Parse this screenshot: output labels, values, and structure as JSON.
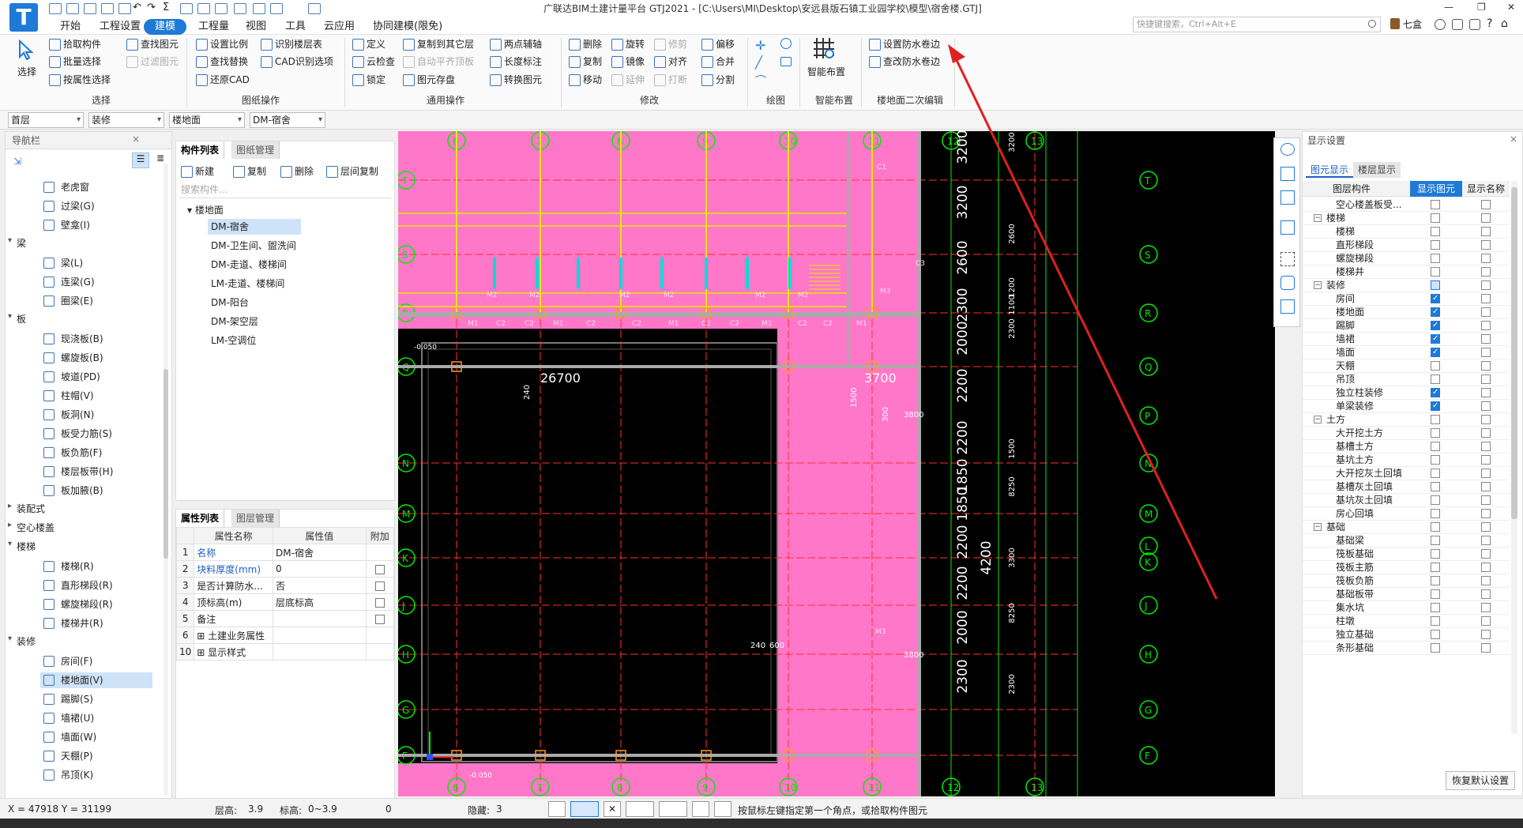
{
  "window": {
    "title": "广联达BIM土建计量平台 GTJ2021 - [C:\\Users\\MI\\Desktop\\安远县版石镇工业园学校\\模型\\宿舍楼.GTJ]",
    "search_placeholder": "快捷键搜索，Ctrl+Alt+E",
    "user": "七盒",
    "logo_letter": "T"
  },
  "menu": [
    "开始",
    "工程设置",
    "建模",
    "工程量",
    "视图",
    "工具",
    "云应用",
    "协同建模(限免)"
  ],
  "ribbon": {
    "select": {
      "big": "选择",
      "items": [
        "拾取构件",
        "批量选择",
        "按属性选择"
      ],
      "group": "选择"
    },
    "find": {
      "items": [
        "查找图元",
        "过滤图元"
      ]
    },
    "drawing_ops": {
      "items": [
        "设置比例",
        "查找替换",
        "还原CAD",
        "识别楼层表",
        "CAD识别选项"
      ],
      "group": "图纸操作"
    },
    "common_ops": {
      "items": [
        "定义",
        "云检查",
        "锁定",
        "复制到其它层",
        "自动平齐顶板",
        "图元存盘",
        "两点辅轴",
        "长度标注",
        "转换图元"
      ],
      "group": "通用操作"
    },
    "modify": {
      "items": [
        "删除",
        "复制",
        "移动",
        "旋转",
        "镜像",
        "延伸",
        "修剪",
        "对齐",
        "打断",
        "偏移",
        "合并",
        "分割"
      ],
      "group": "修改"
    },
    "draw": {
      "group": "绘图"
    },
    "smart": {
      "big": "智能布置",
      "group": "智能布置"
    },
    "floor_edit": {
      "items": [
        "设置防水卷边",
        "查改防水卷边"
      ],
      "group": "楼地面二次编辑"
    }
  },
  "combos": [
    "首层",
    "装修",
    "楼地面",
    "DM-宿舍"
  ],
  "nav": {
    "title": "导航栏",
    "rows": [
      {
        "type": "item",
        "label": "老虎窗"
      },
      {
        "type": "item",
        "label": "过梁(G)"
      },
      {
        "type": "item",
        "label": "壁龛(I)"
      },
      {
        "type": "group",
        "label": "梁"
      },
      {
        "type": "item",
        "label": "梁(L)"
      },
      {
        "type": "item",
        "label": "连梁(G)"
      },
      {
        "type": "item",
        "label": "圈梁(E)"
      },
      {
        "type": "group",
        "label": "板"
      },
      {
        "type": "item",
        "label": "现浇板(B)"
      },
      {
        "type": "item",
        "label": "螺旋板(B)"
      },
      {
        "type": "item",
        "label": "坡道(PD)"
      },
      {
        "type": "item",
        "label": "柱帽(V)"
      },
      {
        "type": "item",
        "label": "板洞(N)"
      },
      {
        "type": "item",
        "label": "板受力筋(S)"
      },
      {
        "type": "item",
        "label": "板负筋(F)"
      },
      {
        "type": "item",
        "label": "楼层板带(H)"
      },
      {
        "type": "item",
        "label": "板加腋(B)"
      },
      {
        "type": "groupc",
        "label": "装配式"
      },
      {
        "type": "groupc",
        "label": "空心楼盖"
      },
      {
        "type": "group",
        "label": "楼梯"
      },
      {
        "type": "item",
        "label": "楼梯(R)"
      },
      {
        "type": "item",
        "label": "直形梯段(R)"
      },
      {
        "type": "item",
        "label": "螺旋梯段(R)"
      },
      {
        "type": "item",
        "label": "楼梯井(R)"
      },
      {
        "type": "group",
        "label": "装修"
      },
      {
        "type": "item",
        "label": "房间(F)"
      },
      {
        "type": "item",
        "label": "楼地面(V)",
        "selected": true
      },
      {
        "type": "item",
        "label": "踢脚(S)"
      },
      {
        "type": "item",
        "label": "墙裙(U)"
      },
      {
        "type": "item",
        "label": "墙面(W)"
      },
      {
        "type": "item",
        "label": "天棚(P)"
      },
      {
        "type": "item",
        "label": "吊顶(K)"
      }
    ]
  },
  "components": {
    "tabs": [
      "构件列表",
      "图纸管理"
    ],
    "toolbar": [
      "新建",
      "复制",
      "删除",
      "层间复制"
    ],
    "search_placeholder": "搜索构件...",
    "root": "楼地面",
    "items": [
      "DM-宿舍",
      "DM-卫生间、盥洗间",
      "DM-走道、楼梯间",
      "LM-走道、楼梯间",
      "DM-阳台",
      "DM-架空层",
      "LM-空调位"
    ],
    "selected": 0
  },
  "properties": {
    "tabs": [
      "属性列表",
      "图层管理"
    ],
    "headers": [
      "",
      "属性名称",
      "属性值",
      "附加"
    ],
    "rows": [
      {
        "n": "1",
        "name": "名称",
        "value": "DM-宿舍",
        "blue": true,
        "chk": false
      },
      {
        "n": "2",
        "name": "块料厚度(mm)",
        "value": "0",
        "blue": true,
        "chk": true
      },
      {
        "n": "3",
        "name": "是否计算防水...",
        "value": "否",
        "blue": false,
        "chk": true
      },
      {
        "n": "4",
        "name": "顶标高(m)",
        "value": "层底标高",
        "blue": false,
        "chk": true
      },
      {
        "n": "5",
        "name": "备注",
        "value": "",
        "blue": false,
        "chk": true
      },
      {
        "n": "6",
        "name": "土建业务属性",
        "value": "",
        "blue": false,
        "chk": false,
        "plus": true
      },
      {
        "n": "10",
        "name": "显示样式",
        "value": "",
        "blue": false,
        "chk": false,
        "plus": true
      }
    ]
  },
  "cad": {
    "top_axes": [
      "6",
      "7",
      "8",
      "9",
      "10",
      "11",
      "12",
      "13"
    ],
    "bottom_axes": [
      "6",
      "7",
      "8",
      "9",
      "10",
      "11",
      "12",
      "13"
    ],
    "left_axes": [
      "T",
      "S",
      "R",
      "Q",
      "N",
      "M",
      "K",
      "J",
      "H",
      "G",
      "F"
    ],
    "right_axes": [
      "T",
      "S",
      "R",
      "Q",
      "P",
      "N",
      "M",
      "L",
      "K",
      "J",
      "H",
      "G",
      "F"
    ],
    "right_dims": [
      "3200",
      "3200",
      "2600",
      "2300",
      "2000",
      "2200",
      "2200",
      "1850",
      "1850",
      "2200",
      "2200",
      "2000",
      "2300"
    ],
    "right_dims_small": [
      "3200",
      "2600",
      "1200",
      "1100",
      "2300",
      "1500",
      "8250",
      "8250",
      "3300",
      "2300"
    ],
    "dims": [
      "26700",
      "3700",
      "3800",
      "3800",
      "240",
      "600",
      "300",
      "1500",
      "-0.050",
      "-0.050",
      "4200",
      "240"
    ],
    "door_labels": [
      "M1",
      "C2",
      "C2",
      "M1",
      "C2",
      "C2",
      "M1",
      "C2",
      "C2",
      "M1",
      "C2",
      "C2",
      "M1",
      "M2",
      "M2",
      "M2",
      "M2",
      "M2",
      "M2",
      "M3",
      "M3",
      "C1",
      "C3"
    ],
    "colors": {
      "floor": "#ff77c8",
      "axis": "#00ee00",
      "grid": "#e8e800",
      "wall": "#aaaaaa",
      "red": "#ff3030"
    }
  },
  "display": {
    "title": "显示设置",
    "tabs": [
      "图元显示",
      "楼层显示"
    ],
    "headers": [
      "图层构件",
      "显示图元",
      "显示名称"
    ],
    "rows": [
      {
        "label": "空心楼盖板受...",
        "group": false,
        "show": false
      },
      {
        "label": "楼梯",
        "group": true,
        "show": false
      },
      {
        "label": "楼梯",
        "group": false,
        "show": false
      },
      {
        "label": "直形梯段",
        "group": false,
        "show": false
      },
      {
        "label": "螺旋梯段",
        "group": false,
        "show": false
      },
      {
        "label": "楼梯井",
        "group": false,
        "show": false
      },
      {
        "label": "装修",
        "group": true,
        "show": false,
        "partial": true
      },
      {
        "label": "房间",
        "group": false,
        "show": true
      },
      {
        "label": "楼地面",
        "group": false,
        "show": true
      },
      {
        "label": "踢脚",
        "group": false,
        "show": true
      },
      {
        "label": "墙裙",
        "group": false,
        "show": true
      },
      {
        "label": "墙面",
        "group": false,
        "show": true
      },
      {
        "label": "天棚",
        "group": false,
        "show": false
      },
      {
        "label": "吊顶",
        "group": false,
        "show": false
      },
      {
        "label": "独立柱装修",
        "group": false,
        "show": true
      },
      {
        "label": "单梁装修",
        "group": false,
        "show": true
      },
      {
        "label": "土方",
        "group": true,
        "show": false
      },
      {
        "label": "大开挖土方",
        "group": false,
        "show": false
      },
      {
        "label": "基槽土方",
        "group": false,
        "show": false
      },
      {
        "label": "基坑土方",
        "group": false,
        "show": false
      },
      {
        "label": "大开挖灰土回填",
        "group": false,
        "show": false
      },
      {
        "label": "基槽灰土回填",
        "group": false,
        "show": false
      },
      {
        "label": "基坑灰土回填",
        "group": false,
        "show": false
      },
      {
        "label": "房心回填",
        "group": false,
        "show": false
      },
      {
        "label": "基础",
        "group": true,
        "show": false
      },
      {
        "label": "基础梁",
        "group": false,
        "show": false
      },
      {
        "label": "筏板基础",
        "group": false,
        "show": false
      },
      {
        "label": "筏板主筋",
        "group": false,
        "show": false
      },
      {
        "label": "筏板负筋",
        "group": false,
        "show": false
      },
      {
        "label": "基础板带",
        "group": false,
        "show": false
      },
      {
        "label": "集水坑",
        "group": false,
        "show": false
      },
      {
        "label": "柱墩",
        "group": false,
        "show": false
      },
      {
        "label": "独立基础",
        "group": false,
        "show": false
      },
      {
        "label": "条形基础",
        "group": false,
        "show": false
      }
    ],
    "restore": "恢复默认设置"
  },
  "status": {
    "coords": "X = 47918 Y = 31199",
    "floor_h_label": "层高:",
    "floor_h": "3.9",
    "elev_label": "标高:",
    "elev": "0~3.9",
    "zero": "0",
    "hidden_label": "隐藏:",
    "hidden": "3",
    "hint": "按鼠标左键指定第一个角点，或拾取构件图元"
  }
}
